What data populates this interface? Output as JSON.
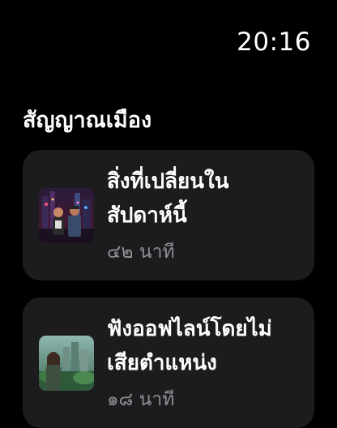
{
  "status_bar": {
    "time": "20:16"
  },
  "section": {
    "title": "สัญญาณเมือง"
  },
  "cards": [
    {
      "title_line1": "สิ่งที่เปลี่ยนใน",
      "title_line2": "สัปดาห์นี้",
      "duration": "๔๒ นาที",
      "thumbnail_icon": "couple-city-night-thumbnail"
    },
    {
      "title_line1": "ฟังออฟไลน์โดยไม่",
      "title_line2": "เสียตำแหน่ง",
      "duration": "๑๘ นาที",
      "thumbnail_icon": "woman-green-city-thumbnail"
    }
  ],
  "colors": {
    "background": "#000000",
    "card": "#1c1c1e",
    "secondary_text": "#8e8e93"
  }
}
